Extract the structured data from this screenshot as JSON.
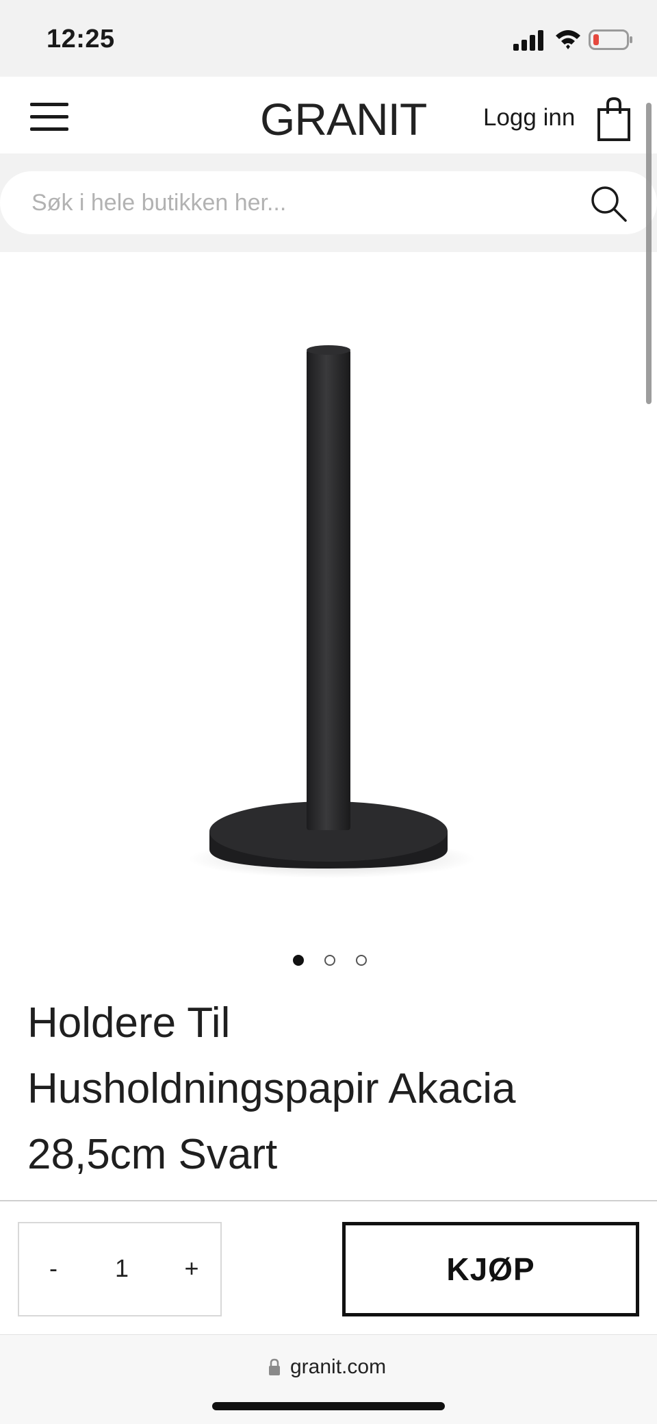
{
  "status_bar": {
    "time": "12:25",
    "icons": [
      "signal-icon",
      "wifi-icon",
      "battery-icon"
    ],
    "battery_color": "#e5483e"
  },
  "header": {
    "brand": "GRANIT",
    "login_label": "Logg inn",
    "icons": [
      "menu-icon",
      "cart-icon"
    ]
  },
  "search": {
    "placeholder": "Søk i hele butikken her...",
    "value": ""
  },
  "product": {
    "image_description_icon": "paper-towel-holder-image",
    "image_color": "#2a2a2c",
    "carousel": {
      "count": 3,
      "active_index": 0
    },
    "title_lines": [
      "Holdere Til",
      "Husholdningspapir Akacia",
      "28,5cm Svart"
    ]
  },
  "purchase": {
    "minus_label": "-",
    "plus_label": "+",
    "quantity": "1",
    "buy_label": "KJØP"
  },
  "browser": {
    "url": "granit.com"
  },
  "colors": {
    "background": "#ffffff",
    "band": "#f2f2f2",
    "text": "#1a1a1a",
    "placeholder": "#b2b2b2"
  }
}
